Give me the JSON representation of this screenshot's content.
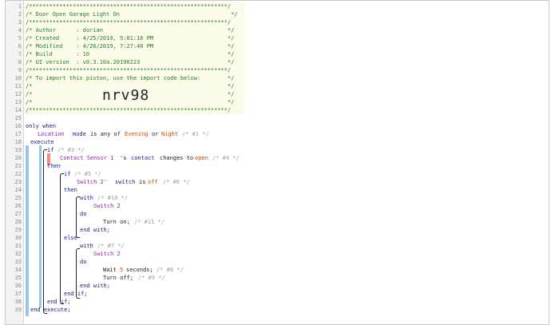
{
  "editor": {
    "line_numbers": [
      "1",
      "2",
      "3",
      "4",
      "5",
      "6",
      "7",
      "8",
      "9",
      "10",
      "11",
      "12",
      "13",
      "14",
      "15",
      "16",
      "17",
      "18",
      "19",
      "20",
      "21",
      "22",
      "23",
      "24",
      "25",
      "26",
      "27",
      "28",
      "29",
      "30",
      "31",
      "32",
      "33",
      "34",
      "35",
      "36",
      "37",
      "38",
      "39"
    ],
    "header": {
      "border_line": "/***********************************************************/",
      "title_line": "/* Door Open Garage Light On                                 */",
      "author_line": "/* Author      : dorian                                     */",
      "created_line": "/* Created     : 4/25/2019, 9:01:16 PM                      */",
      "modified_line": "/* Modified    : 4/26/2019, 7:27:40 PM                      */",
      "build_line": "/* Build       : 10                                         */",
      "ui_version_line": "/* UI version  : v0.3.10a.20190223                          */",
      "import_line": "/* To import this piston, use the import code below:        */",
      "empty_line": "/*                                                          */",
      "import_code": "nrv98"
    },
    "code": {
      "only_when": "only when",
      "location": "Location",
      "mode": "mode",
      "is_any_of": "is any of",
      "evening": "Evening",
      "or": "or",
      "night": "Night",
      "c1": "/* #1 */",
      "execute": "execute",
      "if": "if",
      "c3": "/* #3 */",
      "contact_sensor": "Contact Sensor 1",
      "s": "'s",
      "contact": "contact",
      "changes_to": "changes to",
      "open": "open",
      "c4": "/* #4 */",
      "then": "then",
      "c5": "/* #5 */",
      "switch2_q": "Switch 2'",
      "switch_word": "switch",
      "is": "is",
      "off": "off",
      "c6": "/* #6 */",
      "with": "with",
      "c10": "/* #10 */",
      "switch2": "Switch 2",
      "do": "do",
      "turn_on": "Turn on;",
      "c11": "/* #11 */",
      "end_with": "end with;",
      "else": "else",
      "c7": "/* #7 */",
      "wait": "Wait",
      "five": "5",
      "seconds": "seconds;",
      "c8": "/* #8 */",
      "turn_off": "Turn off;",
      "c9": "/* #9 */",
      "end_if": "end if;",
      "end_execute": "end execute;"
    }
  }
}
